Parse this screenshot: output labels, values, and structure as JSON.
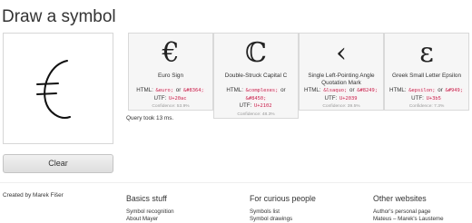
{
  "page": {
    "title": "Draw a symbol",
    "clear_label": "Clear",
    "query_time": "Query took 13 ms."
  },
  "results": [
    {
      "symbol": "€",
      "name": "Euro Sign",
      "html_prefix": "HTML:",
      "html_entity": "&euro;",
      "or1": "or",
      "html_decimal": "&#8364;",
      "html_suffix": "",
      "utf_prefix": "UTF:",
      "utf": "U+20ac",
      "confidence": "Confidence: 53.9%"
    },
    {
      "symbol": "ℂ",
      "name": "Double-Struck Capital C",
      "html_prefix": "HTML:",
      "html_entity": "&complexes;",
      "or1": "or",
      "html_decimal": "&#8450;",
      "html_suffix": "",
      "utf_prefix": "UTF:",
      "utf": "U+2102",
      "confidence": "Confidence: 48.3%"
    },
    {
      "symbol": "‹",
      "name": "Single Left-Pointing Angle Quotation Mark",
      "html_prefix": "HTML:",
      "html_entity": "&lsaquo;",
      "or1": "or",
      "html_decimal": "&#8249;",
      "html_suffix": "",
      "utf_prefix": "UTF:",
      "utf": "U+2039",
      "confidence": "Confidence: 39.5%"
    },
    {
      "symbol": "ε",
      "name": "Greek Small Letter Epsilon",
      "html_prefix": "HTML:",
      "html_entity": "&epsilon;",
      "or1": "or",
      "html_decimal": "&#949;",
      "html_suffix": "",
      "utf_prefix": "UTF:",
      "utf": "U+3b5",
      "confidence": "Confidence: 7.3%"
    }
  ],
  "footer": {
    "credit": "Created by Marek Fišer",
    "columns": [
      {
        "heading": "Basics stuff",
        "links": [
          "Symbol recognition",
          "About Mayer"
        ]
      },
      {
        "heading": "For curious people",
        "links": [
          "Symbols list",
          "Symbol drawings"
        ]
      },
      {
        "heading": "Other websites",
        "links": [
          "Author's personal page",
          "Mateus – Marek's Lausteme"
        ]
      }
    ]
  },
  "colors": {
    "code_text": "#c7254e",
    "card_bg": "#f6f6f6",
    "button_bg": "#e6e6e6"
  }
}
